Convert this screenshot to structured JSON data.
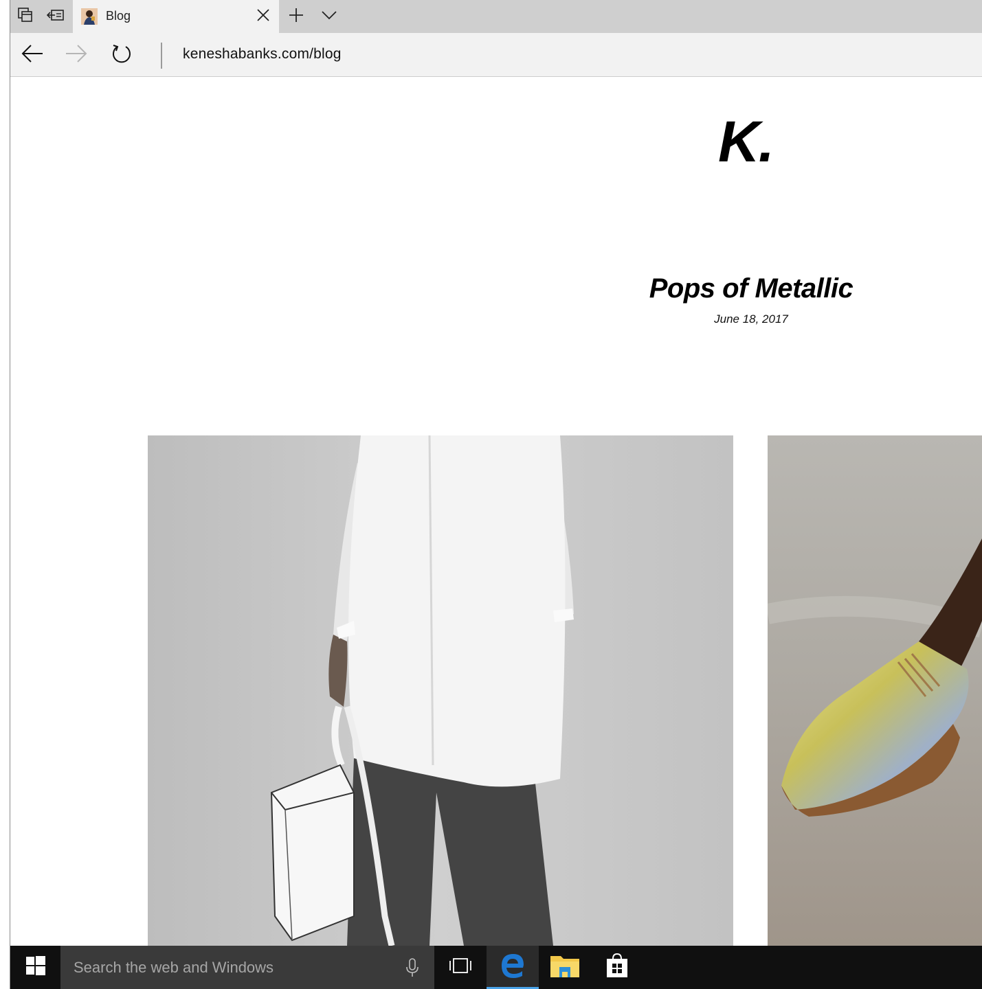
{
  "browser": {
    "tab": {
      "title": "Blog"
    },
    "address": {
      "url": "keneshabanks.com/blog"
    }
  },
  "site": {
    "logo": "K.",
    "post": {
      "title": "Pops of Metallic",
      "date": "June 18, 2017"
    },
    "images": [
      {
        "name": "white-shirt-handbag-photo"
      },
      {
        "name": "gold-metallic-shoe-photo"
      }
    ]
  },
  "taskbar": {
    "search_placeholder": "Search the web and Windows"
  },
  "colors": {
    "tabbar": "#cfcfcf",
    "taskbar": "#101010",
    "edge_blue": "#1e78d2"
  }
}
